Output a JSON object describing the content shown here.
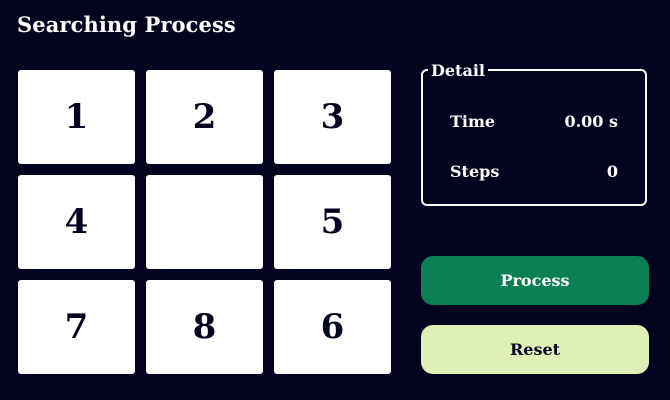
{
  "header": {
    "title": "Searching Process"
  },
  "puzzle": {
    "tiles": [
      "1",
      "2",
      "3",
      "4",
      "",
      "5",
      "7",
      "8",
      "6"
    ]
  },
  "detail": {
    "legend": "Detail",
    "time_label": "Time",
    "time_value": "0.00 s",
    "steps_label": "Steps",
    "steps_value": "0"
  },
  "actions": {
    "process_label": "Process",
    "reset_label": "Reset"
  },
  "colors": {
    "background": "#02031f",
    "tile": "#ffffff",
    "process": "#0d7f55",
    "reset": "#ddf1b6"
  }
}
